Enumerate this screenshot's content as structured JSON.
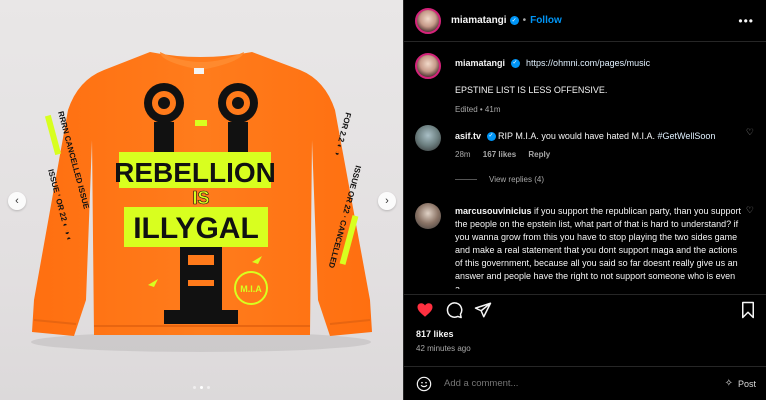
{
  "post": {
    "username": "miamatangi",
    "separator": "•",
    "follow_label": "Follow",
    "more_icon": "more-horizontal-icon"
  },
  "caption": {
    "username": "miamatangi",
    "link": "https://ohmni.com/pages/music",
    "text": "EPSTINE LIST IS LESS OFFENSIVE.",
    "edited": "Edited • 41m"
  },
  "comments": [
    {
      "username": "asif.tv",
      "text": "RIP M.I.A. you would have hated M.I.A.",
      "hashtag": "#GetWellSoon",
      "time": "28m",
      "likes": "167 likes",
      "reply_label": "Reply",
      "view_replies": "View replies (4)"
    },
    {
      "username": "marcusouvinicius",
      "text": "if you support the republican party, than you support the people on the epstein list, what part of that is hard to understand? if you wanna grow from this you have to stop playing the two sides game and make a real statement that you dont support maga and the actions of this government, because all you said so far doesnt really give us an answer and people have the right to not support someone who is even a"
    }
  ],
  "stats": {
    "likes": "817 likes",
    "ago": "42 minutes ago"
  },
  "composer": {
    "placeholder": "Add a comment...",
    "post_label": "Post"
  },
  "image": {
    "shirt_texts": [
      "REBELLION",
      "IS",
      "ILLYGAL"
    ],
    "carousel_total": 3,
    "carousel_active": 2
  },
  "colors": {
    "accent": "#0095f6",
    "like_red": "#ff3040",
    "shirt_orange": "#ff7a1a",
    "neon_yellow": "#d8ff1f"
  }
}
